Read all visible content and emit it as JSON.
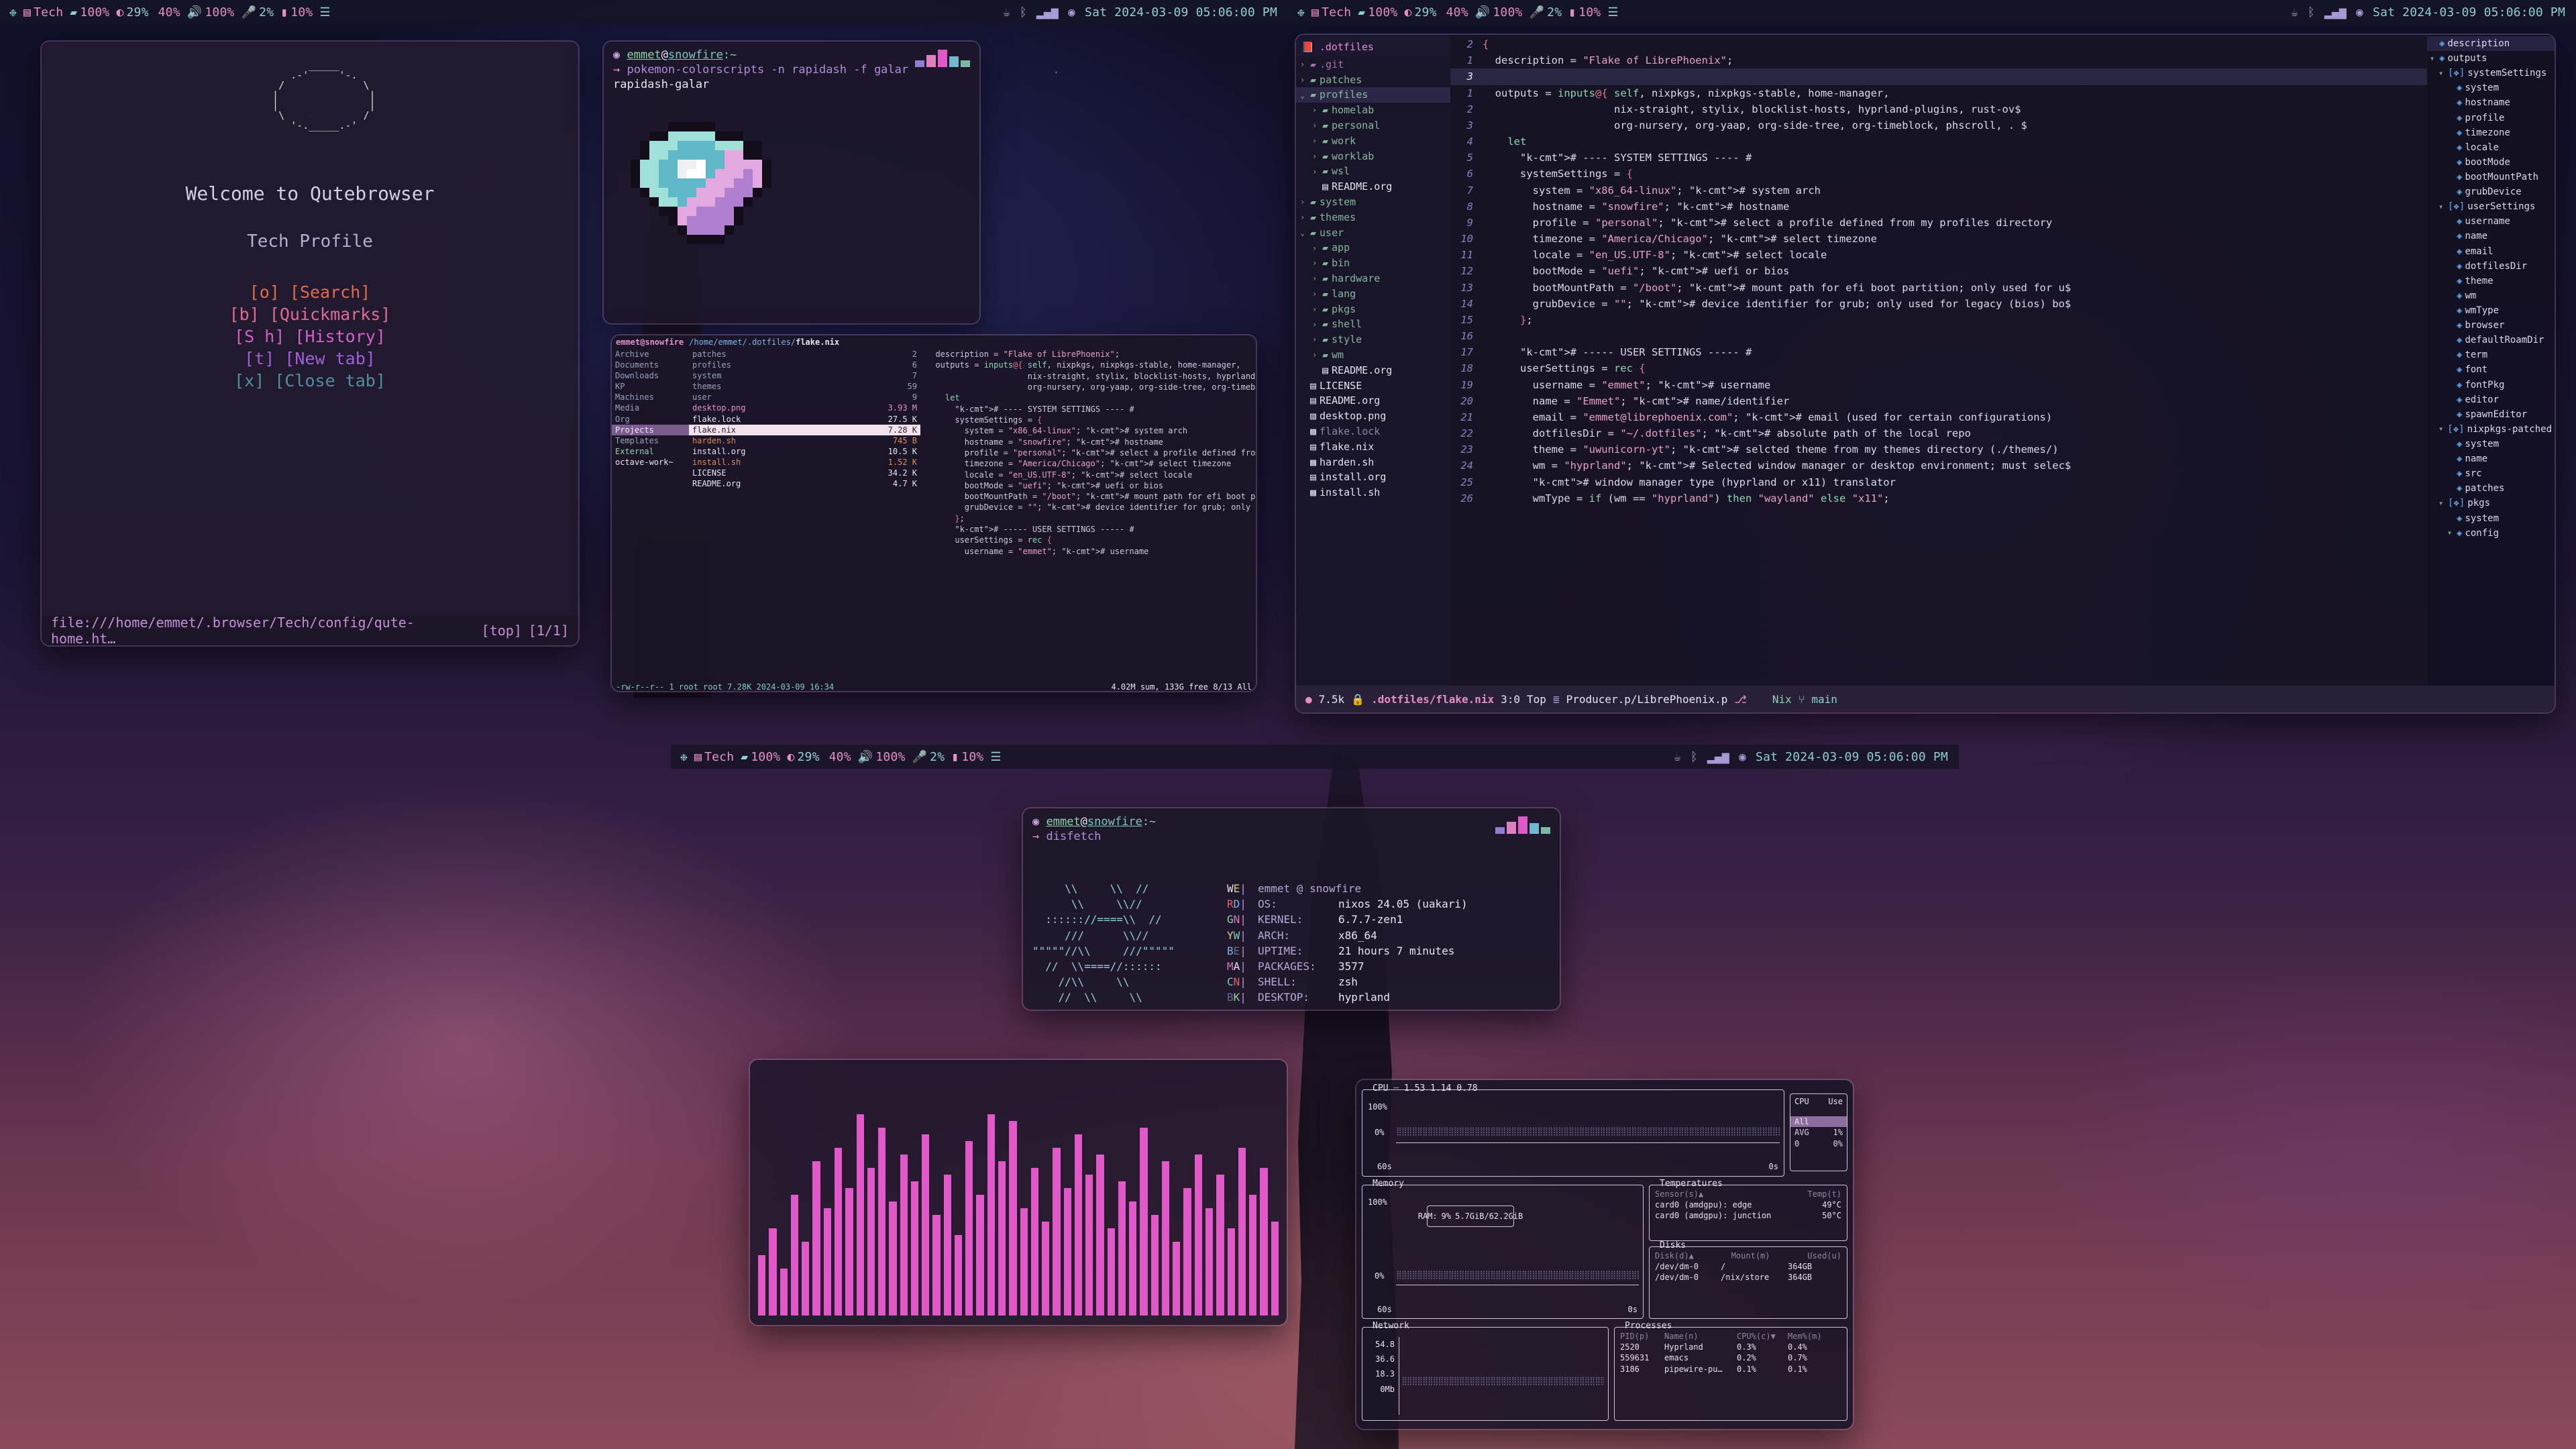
{
  "topbar": {
    "left": [
      {
        "icon": "nix-snowflake-icon",
        "text": ""
      },
      {
        "icon": "workspace-icon",
        "text": "Tech"
      },
      {
        "icon": "battery-icon",
        "text": "100%"
      },
      {
        "icon": "cpu-percent-icon",
        "text": "29%"
      },
      {
        "icon": "brightness-icon",
        "text": "40%"
      },
      {
        "icon": "volume-icon",
        "text": "100%"
      },
      {
        "icon": "microphone-icon",
        "text": "2%"
      },
      {
        "icon": "memory-icon",
        "text": "10%"
      },
      {
        "icon": "menu-icon",
        "text": ""
      }
    ],
    "right": [
      {
        "icon": "coffee-off-icon",
        "text": ""
      },
      {
        "icon": "bluetooth-icon",
        "text": ""
      },
      {
        "icon": "network-signal-icon",
        "text": ""
      },
      {
        "icon": "disc-icon",
        "text": ""
      }
    ],
    "clock": "Sat 2024-03-09 05:06:00 PM"
  },
  "qutebrowser": {
    "ascii": "        _____\n     .-'     '-.\n   /             \\\n  |               |\n  |               |\n   \\             /\n     '-._____.-'",
    "title": "Welcome to Qutebrowser",
    "subtitle": "Tech Profile",
    "links": [
      {
        "key": "[o]",
        "label": "[Search]",
        "color": "#e06c4a"
      },
      {
        "key": "[b]",
        "label": "[Quickmarks]",
        "color": "#e06a96"
      },
      {
        "key": "[S h]",
        "label": "[History]",
        "color": "#d160c8"
      },
      {
        "key": "[t]",
        "label": "[New tab]",
        "color": "#a05fd8"
      },
      {
        "key": "[x]",
        "label": "[Close tab]",
        "color": "#4f8fa0"
      }
    ],
    "status_url": "file:///home/emmet/.browser/Tech/config/qute-home.ht…",
    "status_pos": "[top]",
    "status_tabs": "[1/1]"
  },
  "pokemon_term": {
    "prompt_user": "emmet",
    "prompt_at": "@",
    "prompt_host": "snowfire",
    "prompt_path": ":~",
    "command": "pokemon-colorscripts -n rapidash -f galar",
    "output": "rapidash-galar"
  },
  "ranger": {
    "header_user": "emmet@snowfire",
    "header_path": "/home/emmet/.dotfiles/",
    "header_file": "flake.nix",
    "col1": [
      "Archive",
      "Documents",
      "Downloads",
      "KP",
      "Machines",
      "Media",
      "Org",
      "Projects",
      "Templates",
      "External",
      "octave-work~"
    ],
    "col1_selected": "Projects",
    "col2": [
      {
        "name": "patches",
        "size": "2",
        "type": "dir"
      },
      {
        "name": "profiles",
        "size": "6",
        "type": "dir"
      },
      {
        "name": "system",
        "size": "7",
        "type": "dir"
      },
      {
        "name": "themes",
        "size": "59",
        "type": "dir"
      },
      {
        "name": "user",
        "size": "9",
        "type": "dir"
      },
      {
        "name": "desktop.png",
        "size": "3.93 M",
        "type": "img"
      },
      {
        "name": "flake.lock",
        "size": "27.5 K",
        "type": "file"
      },
      {
        "name": "flake.nix",
        "size": "7.28 K",
        "type": "sel"
      },
      {
        "name": "harden.sh",
        "size": "745 B",
        "type": "exe"
      },
      {
        "name": "install.org",
        "size": "10.5 K",
        "type": "file"
      },
      {
        "name": "install.sh",
        "size": "1.52 K",
        "type": "exe"
      },
      {
        "name": "LICENSE",
        "size": "34.2 K",
        "type": "file"
      },
      {
        "name": "README.org",
        "size": "4.7 K",
        "type": "file"
      }
    ],
    "status_left": "-rw-r--r-- 1 root root 7.28K 2024-03-09 16:34",
    "status_right": "4.02M sum, 133G free  8/13  All"
  },
  "emacs": {
    "tree_title": ".dotfiles",
    "tree": [
      {
        "depth": 0,
        "arrow": "›",
        "icon": "folder-icon",
        "label": ".git",
        "kind": "git"
      },
      {
        "depth": 0,
        "arrow": "›",
        "icon": "folder-icon",
        "label": "patches",
        "kind": "dir"
      },
      {
        "depth": 0,
        "arrow": "⌄",
        "icon": "folder-open-icon",
        "label": "profiles",
        "kind": "dir",
        "hl": true
      },
      {
        "depth": 1,
        "arrow": "›",
        "icon": "folder-icon",
        "label": "homelab",
        "kind": "dir"
      },
      {
        "depth": 1,
        "arrow": "›",
        "icon": "folder-icon",
        "label": "personal",
        "kind": "dir"
      },
      {
        "depth": 1,
        "arrow": "›",
        "icon": "folder-icon",
        "label": "work",
        "kind": "dir"
      },
      {
        "depth": 1,
        "arrow": "›",
        "icon": "folder-icon",
        "label": "worklab",
        "kind": "dir"
      },
      {
        "depth": 1,
        "arrow": "›",
        "icon": "folder-icon",
        "label": "wsl",
        "kind": "dir"
      },
      {
        "depth": 1,
        "arrow": "",
        "icon": "file-icon",
        "label": "README.org",
        "kind": "file"
      },
      {
        "depth": 0,
        "arrow": "›",
        "icon": "folder-icon",
        "label": "system",
        "kind": "dir"
      },
      {
        "depth": 0,
        "arrow": "›",
        "icon": "folder-icon",
        "label": "themes",
        "kind": "dir"
      },
      {
        "depth": 0,
        "arrow": "⌄",
        "icon": "folder-open-icon",
        "label": "user",
        "kind": "dir"
      },
      {
        "depth": 1,
        "arrow": "›",
        "icon": "folder-icon",
        "label": "app",
        "kind": "dir"
      },
      {
        "depth": 1,
        "arrow": "›",
        "icon": "folder-icon",
        "label": "bin",
        "kind": "dir"
      },
      {
        "depth": 1,
        "arrow": "›",
        "icon": "folder-icon",
        "label": "hardware",
        "kind": "dir"
      },
      {
        "depth": 1,
        "arrow": "›",
        "icon": "folder-icon",
        "label": "lang",
        "kind": "dir"
      },
      {
        "depth": 1,
        "arrow": "›",
        "icon": "folder-icon",
        "label": "pkgs",
        "kind": "dir"
      },
      {
        "depth": 1,
        "arrow": "›",
        "icon": "folder-icon",
        "label": "shell",
        "kind": "dir"
      },
      {
        "depth": 1,
        "arrow": "›",
        "icon": "folder-icon",
        "label": "style",
        "kind": "dir"
      },
      {
        "depth": 1,
        "arrow": "›",
        "icon": "folder-icon",
        "label": "wm",
        "kind": "dir"
      },
      {
        "depth": 1,
        "arrow": "",
        "icon": "file-icon",
        "label": "README.org",
        "kind": "file"
      },
      {
        "depth": 0,
        "arrow": "",
        "icon": "file-icon",
        "label": "LICENSE",
        "kind": "file"
      },
      {
        "depth": 0,
        "arrow": "",
        "icon": "file-icon",
        "label": "README.org",
        "kind": "file"
      },
      {
        "depth": 0,
        "arrow": "",
        "icon": "image-icon",
        "label": "desktop.png",
        "kind": "file"
      },
      {
        "depth": 0,
        "arrow": "",
        "icon": "binary-icon",
        "label": "flake.lock",
        "kind": "dimmed"
      },
      {
        "depth": 0,
        "arrow": "",
        "icon": "file-icon",
        "label": "flake.nix",
        "kind": "file"
      },
      {
        "depth": 0,
        "arrow": "",
        "icon": "binary-icon",
        "label": "harden.sh",
        "kind": "file"
      },
      {
        "depth": 0,
        "arrow": "",
        "icon": "file-icon",
        "label": "install.org",
        "kind": "file"
      },
      {
        "depth": 0,
        "arrow": "",
        "icon": "binary-icon",
        "label": "install.sh",
        "kind": "file"
      }
    ],
    "code_lines": [
      {
        "num": "2",
        "cur": false,
        "text": "{"
      },
      {
        "num": "1",
        "cur": false,
        "text": "  description = \"Flake of LibrePhoenix\";"
      },
      {
        "num": "3",
        "cur": true,
        "text": ""
      },
      {
        "num": "1",
        "cur": false,
        "text": "  outputs = inputs@{ self, nixpkgs, nixpkgs-stable, home-manager,"
      },
      {
        "num": "2",
        "cur": false,
        "text": "                     nix-straight, stylix, blocklist-hosts, hyprland-plugins, rust-ov$"
      },
      {
        "num": "3",
        "cur": false,
        "text": "                     org-nursery, org-yaap, org-side-tree, org-timeblock, phscroll, . $"
      },
      {
        "num": "4",
        "cur": false,
        "text": "    let"
      },
      {
        "num": "5",
        "cur": false,
        "text": "      # ---- SYSTEM SETTINGS ---- #"
      },
      {
        "num": "6",
        "cur": false,
        "text": "      systemSettings = {"
      },
      {
        "num": "7",
        "cur": false,
        "text": "        system = \"x86_64-linux\"; # system arch"
      },
      {
        "num": "8",
        "cur": false,
        "text": "        hostname = \"snowfire\"; # hostname"
      },
      {
        "num": "9",
        "cur": false,
        "text": "        profile = \"personal\"; # select a profile defined from my profiles directory"
      },
      {
        "num": "10",
        "cur": false,
        "text": "        timezone = \"America/Chicago\"; # select timezone"
      },
      {
        "num": "11",
        "cur": false,
        "text": "        locale = \"en_US.UTF-8\"; # select locale"
      },
      {
        "num": "12",
        "cur": false,
        "text": "        bootMode = \"uefi\"; # uefi or bios"
      },
      {
        "num": "13",
        "cur": false,
        "text": "        bootMountPath = \"/boot\"; # mount path for efi boot partition; only used for u$"
      },
      {
        "num": "14",
        "cur": false,
        "text": "        grubDevice = \"\"; # device identifier for grub; only used for legacy (bios) bo$"
      },
      {
        "num": "15",
        "cur": false,
        "text": "      };"
      },
      {
        "num": "16",
        "cur": false,
        "text": ""
      },
      {
        "num": "17",
        "cur": false,
        "text": "      # ----- USER SETTINGS ----- #"
      },
      {
        "num": "18",
        "cur": false,
        "text": "      userSettings = rec {"
      },
      {
        "num": "19",
        "cur": false,
        "text": "        username = \"emmet\"; # username"
      },
      {
        "num": "20",
        "cur": false,
        "text": "        name = \"Emmet\"; # name/identifier"
      },
      {
        "num": "21",
        "cur": false,
        "text": "        email = \"emmet@librephoenix.com\"; # email (used for certain configurations)"
      },
      {
        "num": "22",
        "cur": false,
        "text": "        dotfilesDir = \"~/.dotfiles\"; # absolute path of the local repo"
      },
      {
        "num": "23",
        "cur": false,
        "text": "        theme = \"uwunicorn-yt\"; # selcted theme from my themes directory (./themes/)"
      },
      {
        "num": "24",
        "cur": false,
        "text": "        wm = \"hyprland\"; # Selected window manager or desktop environment; must selec$"
      },
      {
        "num": "25",
        "cur": false,
        "text": "        # window manager type (hyprland or x11) translator"
      },
      {
        "num": "26",
        "cur": false,
        "text": "        wmType = if (wm == \"hyprland\") then \"wayland\" else \"x11\";"
      }
    ],
    "outline": [
      {
        "depth": 0,
        "arrow": "",
        "icon": "cube-icon",
        "label": "description",
        "hl": true
      },
      {
        "depth": 0,
        "arrow": "▾",
        "icon": "cube-icon",
        "label": "outputs"
      },
      {
        "depth": 1,
        "arrow": "▾",
        "icon": "set-icon",
        "label": "systemSettings"
      },
      {
        "depth": 2,
        "arrow": "",
        "icon": "cube-icon",
        "label": "system"
      },
      {
        "depth": 2,
        "arrow": "",
        "icon": "cube-icon",
        "label": "hostname"
      },
      {
        "depth": 2,
        "arrow": "",
        "icon": "cube-icon",
        "label": "profile"
      },
      {
        "depth": 2,
        "arrow": "",
        "icon": "cube-icon",
        "label": "timezone"
      },
      {
        "depth": 2,
        "arrow": "",
        "icon": "cube-icon",
        "label": "locale"
      },
      {
        "depth": 2,
        "arrow": "",
        "icon": "cube-icon",
        "label": "bootMode"
      },
      {
        "depth": 2,
        "arrow": "",
        "icon": "cube-icon",
        "label": "bootMountPath"
      },
      {
        "depth": 2,
        "arrow": "",
        "icon": "cube-icon",
        "label": "grubDevice"
      },
      {
        "depth": 1,
        "arrow": "▾",
        "icon": "set-icon",
        "label": "userSettings"
      },
      {
        "depth": 2,
        "arrow": "",
        "icon": "cube-icon",
        "label": "username"
      },
      {
        "depth": 2,
        "arrow": "",
        "icon": "cube-icon",
        "label": "name"
      },
      {
        "depth": 2,
        "arrow": "",
        "icon": "cube-icon",
        "label": "email"
      },
      {
        "depth": 2,
        "arrow": "",
        "icon": "cube-icon",
        "label": "dotfilesDir"
      },
      {
        "depth": 2,
        "arrow": "",
        "icon": "cube-icon",
        "label": "theme"
      },
      {
        "depth": 2,
        "arrow": "",
        "icon": "cube-icon",
        "label": "wm"
      },
      {
        "depth": 2,
        "arrow": "",
        "icon": "cube-icon",
        "label": "wmType"
      },
      {
        "depth": 2,
        "arrow": "",
        "icon": "cube-icon",
        "label": "browser"
      },
      {
        "depth": 2,
        "arrow": "",
        "icon": "cube-icon",
        "label": "defaultRoamDir"
      },
      {
        "depth": 2,
        "arrow": "",
        "icon": "cube-icon",
        "label": "term"
      },
      {
        "depth": 2,
        "arrow": "",
        "icon": "cube-icon",
        "label": "font"
      },
      {
        "depth": 2,
        "arrow": "",
        "icon": "cube-icon",
        "label": "fontPkg"
      },
      {
        "depth": 2,
        "arrow": "",
        "icon": "cube-icon",
        "label": "editor"
      },
      {
        "depth": 2,
        "arrow": "",
        "icon": "cube-icon",
        "label": "spawnEditor"
      },
      {
        "depth": 1,
        "arrow": "▾",
        "icon": "set-icon",
        "label": "nixpkgs-patched"
      },
      {
        "depth": 2,
        "arrow": "",
        "icon": "cube-icon",
        "label": "system"
      },
      {
        "depth": 2,
        "arrow": "",
        "icon": "cube-icon",
        "label": "name"
      },
      {
        "depth": 2,
        "arrow": "",
        "icon": "cube-icon",
        "label": "src"
      },
      {
        "depth": 2,
        "arrow": "",
        "icon": "cube-icon",
        "label": "patches"
      },
      {
        "depth": 1,
        "arrow": "▾",
        "icon": "set-icon",
        "label": "pkgs"
      },
      {
        "depth": 2,
        "arrow": "",
        "icon": "cube-icon",
        "label": "system"
      },
      {
        "depth": 2,
        "arrow": "▾",
        "icon": "cube-icon",
        "label": "config"
      }
    ],
    "modeline": {
      "size": "7.5k",
      "lock_icon": "lock-icon",
      "file": ".dotfiles/flake.nix",
      "position": "3:0",
      "scroll": "Top",
      "workspace_icon": "stack-icon",
      "project": "Producer.p/LibrePhoenix.p",
      "branch_icon": "git-branch-icon",
      "mode": "Nix",
      "vcs_icon": "git-icon",
      "vcs": "main"
    }
  },
  "disfetch": {
    "prompt_user": "emmet",
    "prompt_host": "snowfire",
    "prompt_path": ":~",
    "command": "disfetch",
    "logo": [
      "     \\\\     \\\\  //",
      "      \\\\     \\\\//",
      "  :::::://====\\\\  //",
      "     ///      \\\\//",
      "\"\"\"\"\"//\\\\     ///\"\"\"\"\"",
      "  //  \\\\====//::::::",
      "    //\\\\     \\\\",
      "    //  \\\\     \\\\"
    ],
    "colorcodes": [
      "WE",
      "RD",
      "GN",
      "YW",
      "BE",
      "MA",
      "CN",
      "BK"
    ],
    "title": "emmet @ snowfire",
    "rows": [
      {
        "key": "OS:",
        "value": "nixos 24.05 (uakari)"
      },
      {
        "key": "KERNEL:",
        "value": "6.7.7-zen1"
      },
      {
        "key": "ARCH:",
        "value": "x86_64"
      },
      {
        "key": "UPTIME:",
        "value": "21 hours 7 minutes"
      },
      {
        "key": "PACKAGES:",
        "value": "3577"
      },
      {
        "key": "SHELL:",
        "value": "zsh"
      },
      {
        "key": "DESKTOP:",
        "value": "hyprland"
      }
    ]
  },
  "btop": {
    "cpu": {
      "label": "CPU",
      "load": "1.53 1.14 0.78",
      "ymax": "100%",
      "ymin": "0%",
      "xleft": "60s",
      "xright": "0s",
      "side_header_a": "CPU",
      "side_header_b": "Use",
      "side_rows": [
        {
          "a": "All",
          "b": "",
          "sel": true
        },
        {
          "a": "AVG",
          "b": "1%",
          "sel": false
        },
        {
          "a": "0",
          "b": "0%",
          "sel": false
        }
      ]
    },
    "memory": {
      "label": "Memory",
      "ymax": "100%",
      "ymin": "0%",
      "xleft": "60s",
      "xright": "0s",
      "ram_label": "RAM:",
      "ram_pct": "9%",
      "ram_text": "5.7GiB/62.2GiB"
    },
    "temps": {
      "label": "Temperatures",
      "col_sensor": "Sensor(s)▲",
      "col_temp": "Temp(t)",
      "rows": [
        {
          "sensor": "card0 (amdgpu): edge",
          "temp": "49°C"
        },
        {
          "sensor": "card0 (amdgpu): junction",
          "temp": "50°C"
        }
      ]
    },
    "disks": {
      "label": "Disks",
      "col_disk": "Disk(d)▲",
      "col_mount": "Mount(m)",
      "col_used": "Used(u)",
      "rows": [
        {
          "disk": "/dev/dm-0",
          "mount": "/",
          "used": "364GB"
        },
        {
          "disk": "/dev/dm-0",
          "mount": "/nix/store",
          "used": "364GB"
        }
      ]
    },
    "network": {
      "label": "Network",
      "yticks": [
        "54.8",
        "36.6",
        "18.3",
        "0Mb"
      ]
    },
    "processes": {
      "label": "Processes",
      "col_pid": "PID(p)",
      "col_name": "Name(n)",
      "col_cpu": "CPU%(c)▼",
      "col_mem": "Mem%(m)",
      "rows": [
        {
          "pid": "2520",
          "name": "Hyprland",
          "cpu": "0.3%",
          "mem": "0.4%"
        },
        {
          "pid": "559631",
          "name": "emacs",
          "cpu": "0.2%",
          "mem": "0.7%"
        },
        {
          "pid": "3186",
          "name": "pipewire-pu…",
          "cpu": "0.1%",
          "mem": "0.1%"
        }
      ]
    }
  },
  "colors": {
    "accent": "#e158c8",
    "pink": "#e48fc9",
    "green": "#86b79a",
    "blue": "#63a9ec",
    "bg": "#1a1426"
  }
}
